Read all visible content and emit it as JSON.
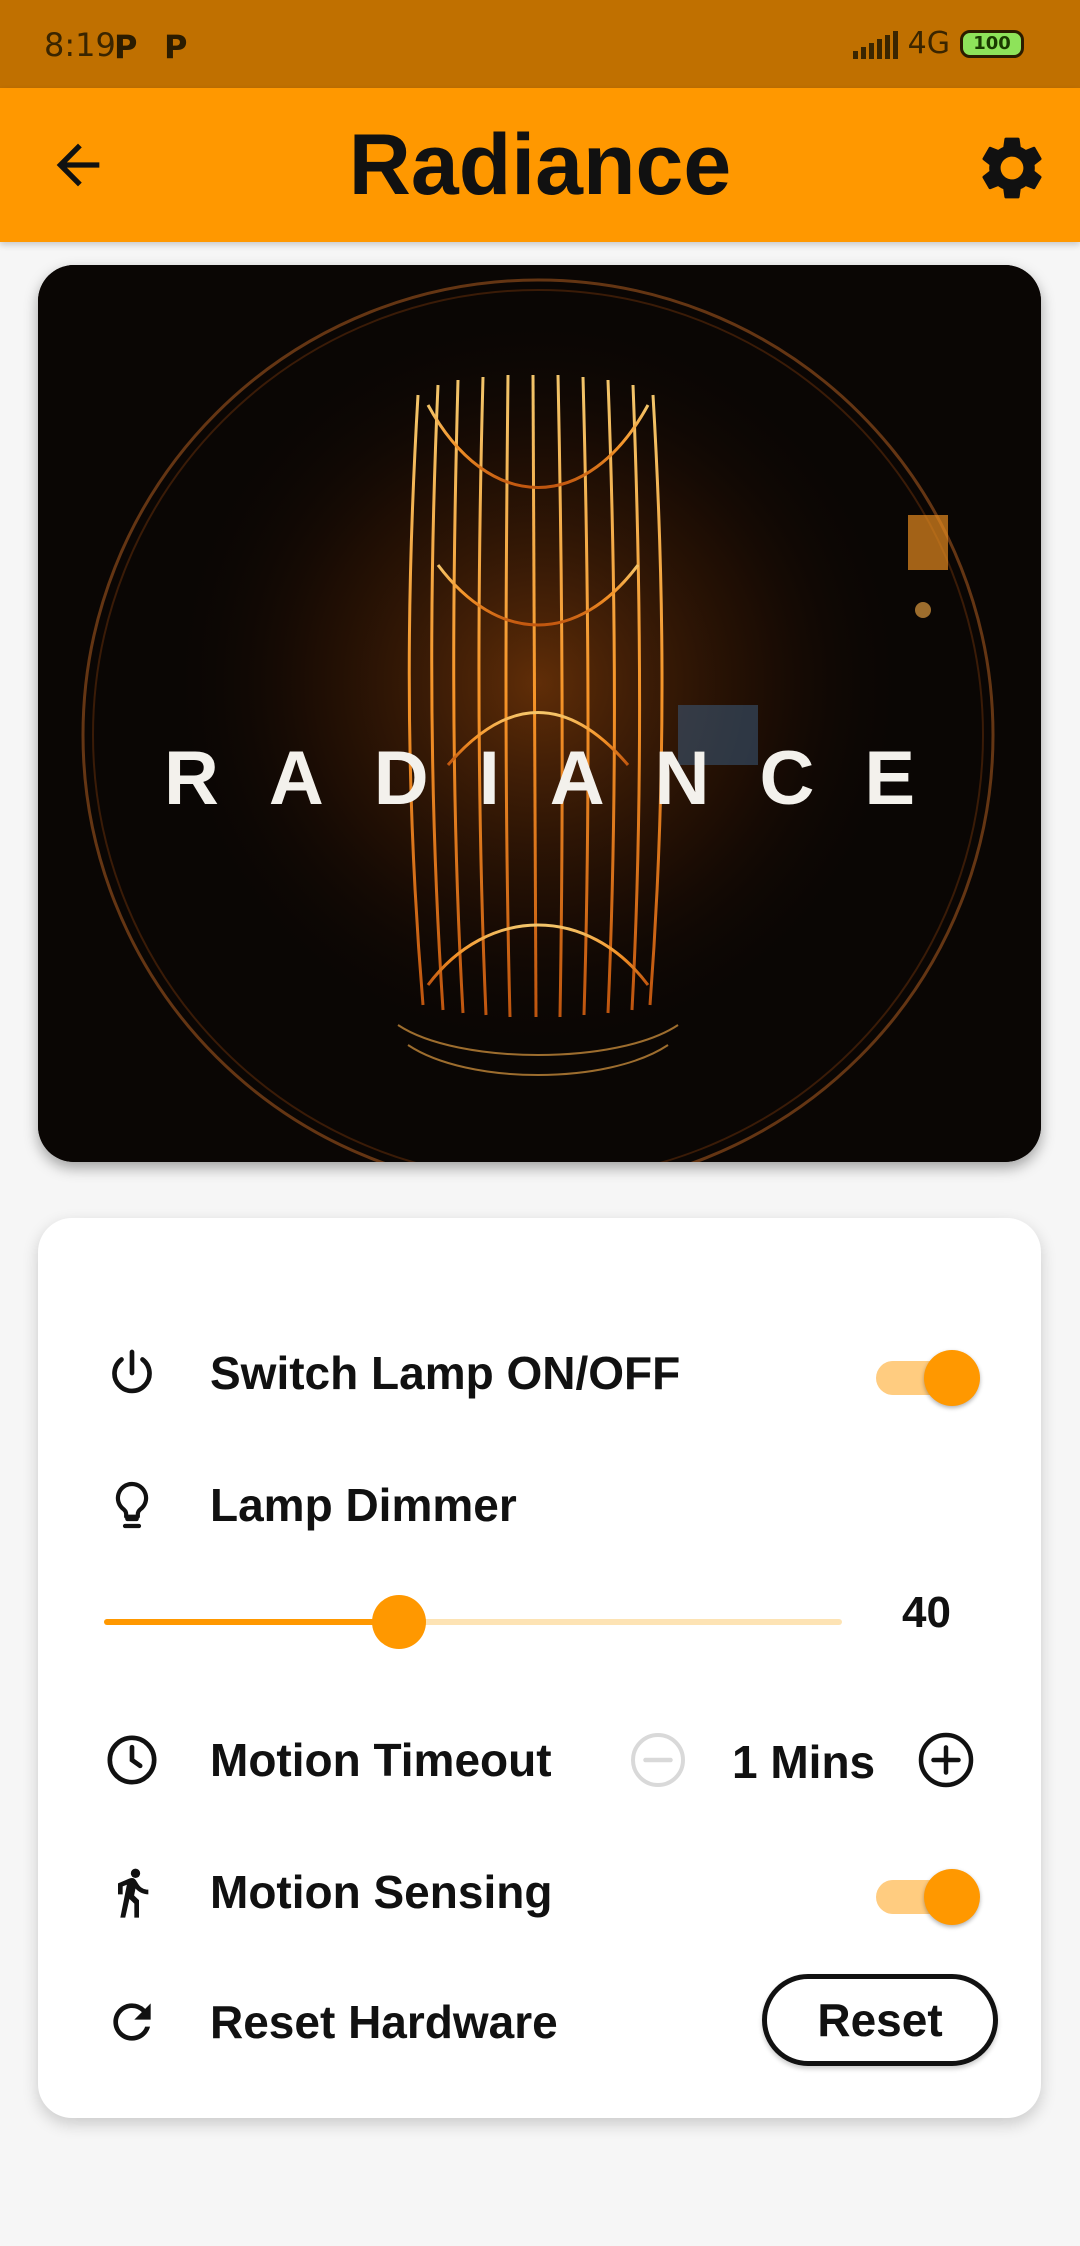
{
  "status_bar": {
    "time": "8:19",
    "notification_badges": [
      "P",
      "P"
    ],
    "network": "4G",
    "battery": "100"
  },
  "app_bar": {
    "title": "Radiance",
    "back_icon": "arrow-left-icon",
    "settings_icon": "gear-icon"
  },
  "hero": {
    "overlay_text": "RADIANCE"
  },
  "controls": {
    "lamp_power": {
      "label": "Switch Lamp ON/OFF",
      "icon": "power-icon",
      "on": true
    },
    "dimmer": {
      "label": "Lamp Dimmer",
      "icon": "lightbulb-icon",
      "value": "40",
      "max": 100
    },
    "motion_timeout": {
      "label": "Motion Timeout",
      "icon": "clock-icon",
      "value": "1 Mins"
    },
    "motion_sensing": {
      "label": "Motion Sensing",
      "icon": "walking-person-icon",
      "on": true
    },
    "reset": {
      "label": "Reset Hardware",
      "icon": "refresh-icon",
      "button_label": "Reset"
    }
  },
  "colors": {
    "accent": "#ff9800",
    "status_bar": "#c07000",
    "toggle_track": "#ffcc80"
  }
}
